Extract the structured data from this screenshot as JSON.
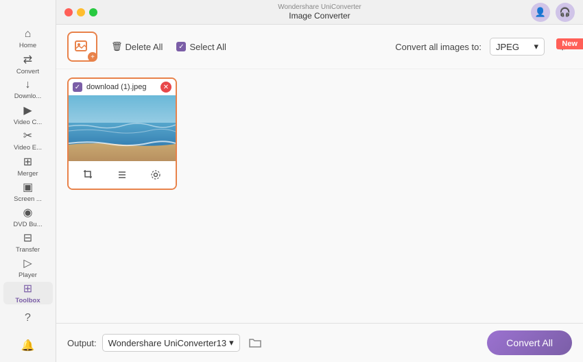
{
  "app": {
    "title": "Wondershare UniConverter",
    "subtitle": "Image Converter"
  },
  "toolbar": {
    "delete_all_label": "Delete All",
    "select_all_label": "Select All",
    "convert_label": "Convert all images to:",
    "format": "JPEG",
    "new_badge": "New"
  },
  "image": {
    "filename": "download (1).jpeg",
    "actions": [
      "crop",
      "list",
      "settings"
    ]
  },
  "footer": {
    "output_label": "Output:",
    "output_path": "Wondershare UniConverter13",
    "convert_all_label": "Convert All"
  },
  "sidebar": {
    "items": [
      {
        "label": "Home",
        "icon": "⌂"
      },
      {
        "label": "Convert",
        "icon": "⇄"
      },
      {
        "label": "Downlo...",
        "icon": "↓"
      },
      {
        "label": "Video C...",
        "icon": "▶"
      },
      {
        "label": "Video E...",
        "icon": "✂"
      },
      {
        "label": "Merger",
        "icon": "⊞"
      },
      {
        "label": "Screen ...",
        "icon": "▣"
      },
      {
        "label": "DVD Bu...",
        "icon": "◉"
      },
      {
        "label": "Transfer",
        "icon": "⊟"
      },
      {
        "label": "Player",
        "icon": "▷"
      },
      {
        "label": "Toolbox",
        "icon": "⊞",
        "active": true
      }
    ],
    "bottom": {
      "help": "?",
      "bell": "🔔"
    }
  }
}
